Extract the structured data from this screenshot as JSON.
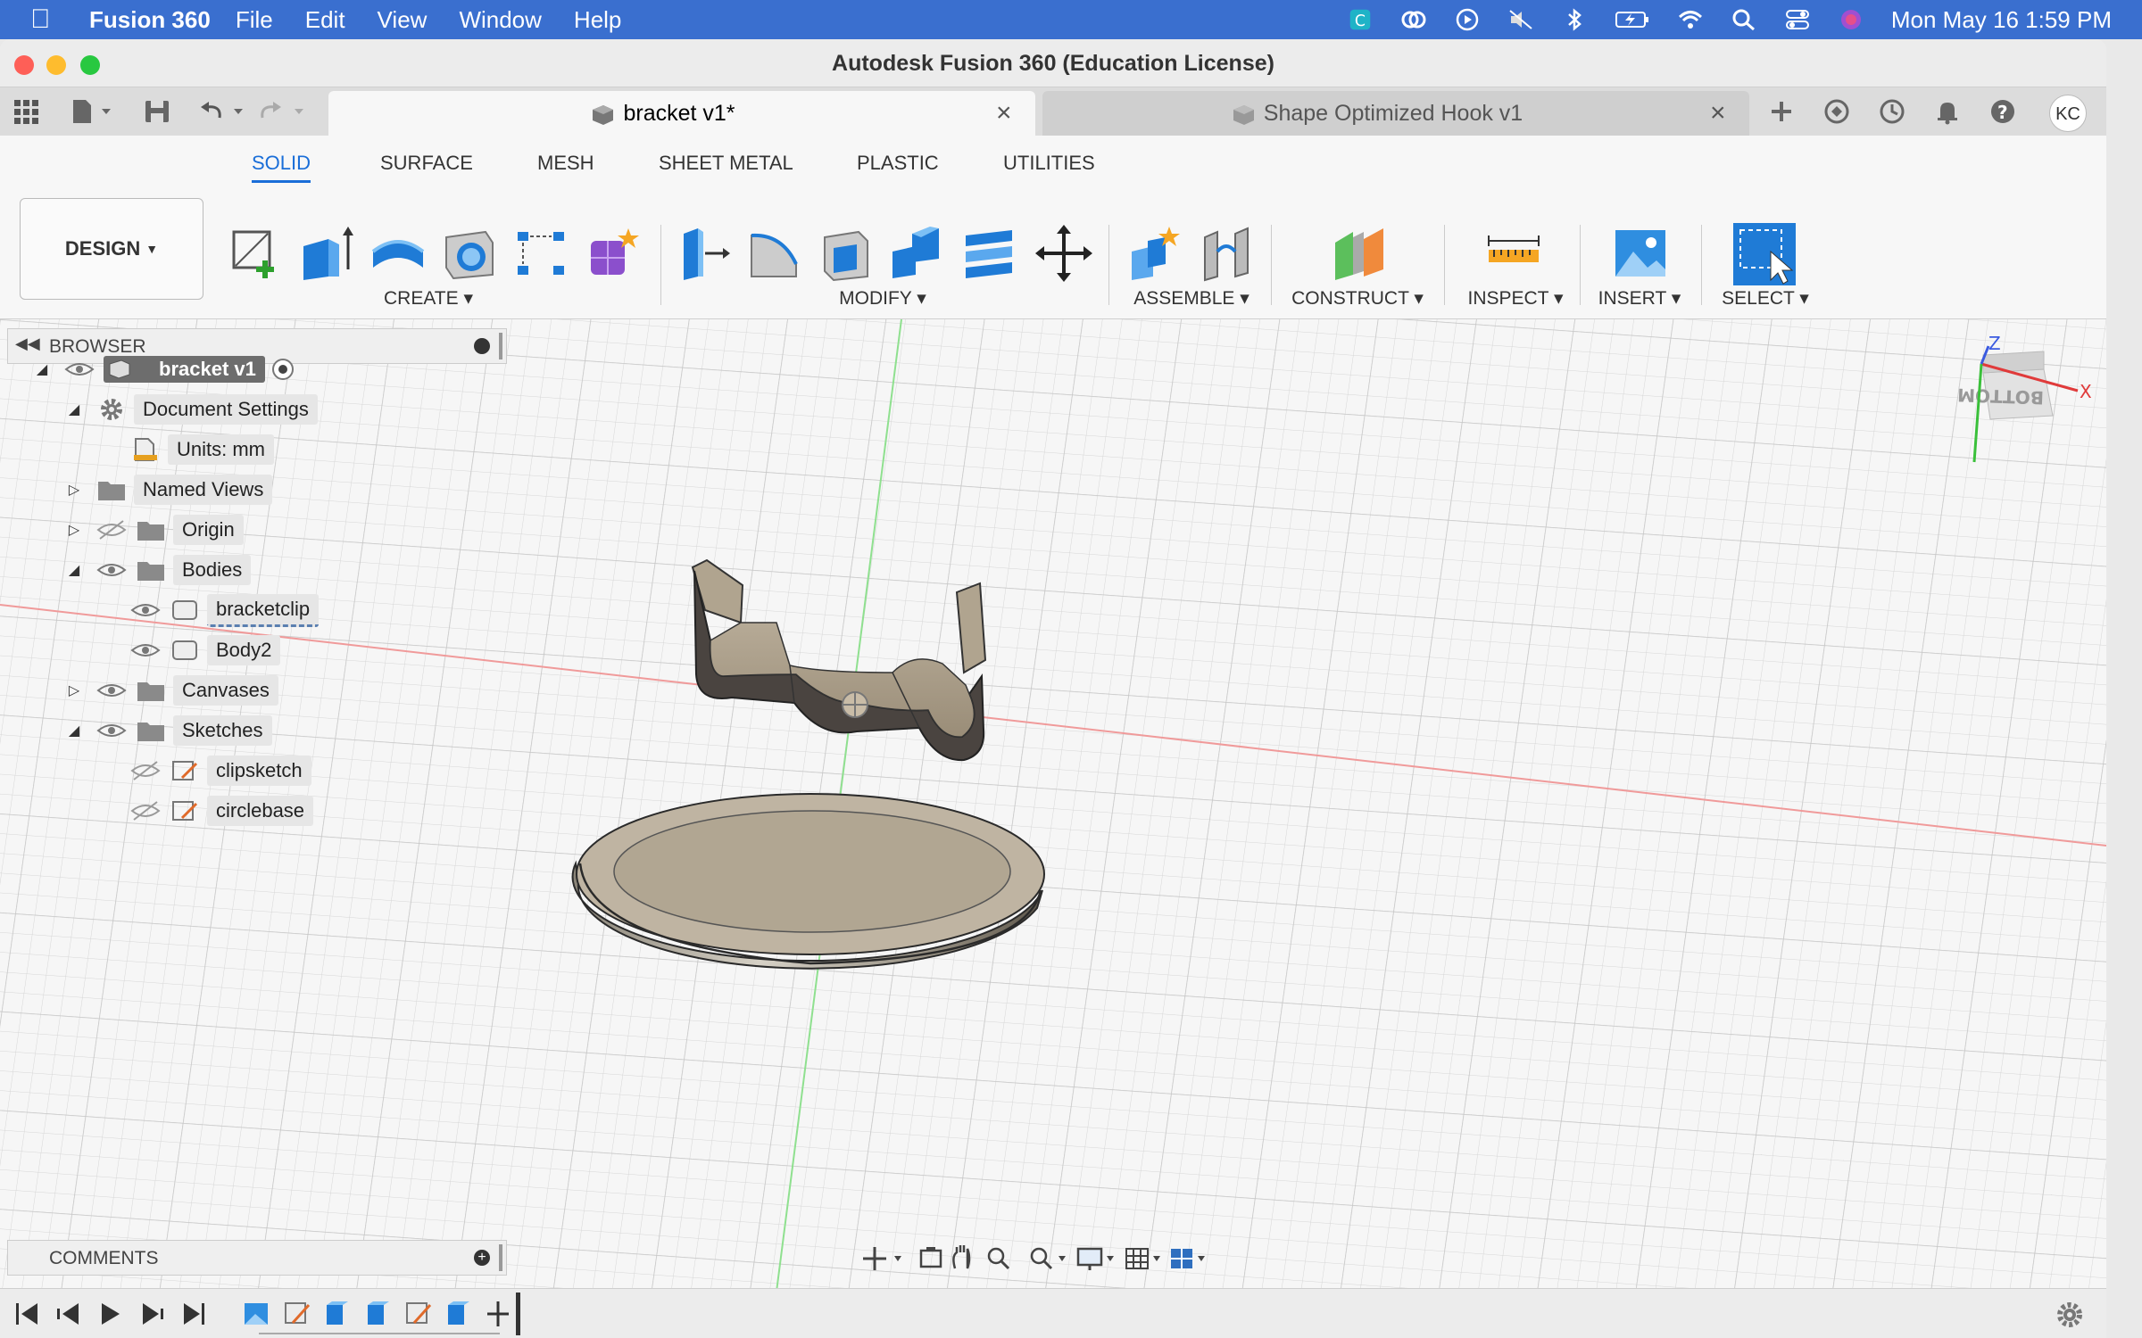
{
  "menubar": {
    "app_name": "Fusion 360",
    "menus": [
      "File",
      "Edit",
      "View",
      "Window",
      "Help"
    ],
    "clock": "Mon May 16  1:59 PM"
  },
  "window": {
    "title": "Autodesk Fusion 360 (Education License)",
    "tabs": [
      {
        "label": "bracket v1*",
        "active": true
      },
      {
        "label": "Shape Optimized Hook v1",
        "active": false
      }
    ],
    "user_initials": "KC"
  },
  "ribbon": {
    "workspace": "DESIGN",
    "tabs": [
      "SOLID",
      "SURFACE",
      "MESH",
      "SHEET METAL",
      "PLASTIC",
      "UTILITIES"
    ],
    "groups": [
      "CREATE",
      "MODIFY",
      "ASSEMBLE",
      "CONSTRUCT",
      "INSPECT",
      "INSERT",
      "SELECT"
    ]
  },
  "browser": {
    "title": "BROWSER",
    "items": [
      {
        "label": "bracket v1"
      },
      {
        "label": "Document Settings"
      },
      {
        "label": "Units: mm"
      },
      {
        "label": "Named Views"
      },
      {
        "label": "Origin"
      },
      {
        "label": "Bodies"
      },
      {
        "label": "bracketclip"
      },
      {
        "label": "Body2"
      },
      {
        "label": "Canvases"
      },
      {
        "label": "Sketches"
      },
      {
        "label": "clipsketch"
      },
      {
        "label": "circlebase"
      }
    ]
  },
  "comments": {
    "title": "COMMENTS"
  },
  "viewcube": {
    "face": "BOTTOM",
    "x_axis": "X",
    "z_axis": "Z"
  },
  "colors": {
    "accent": "#1a6ed8",
    "menubar": "#3a6fcf"
  }
}
